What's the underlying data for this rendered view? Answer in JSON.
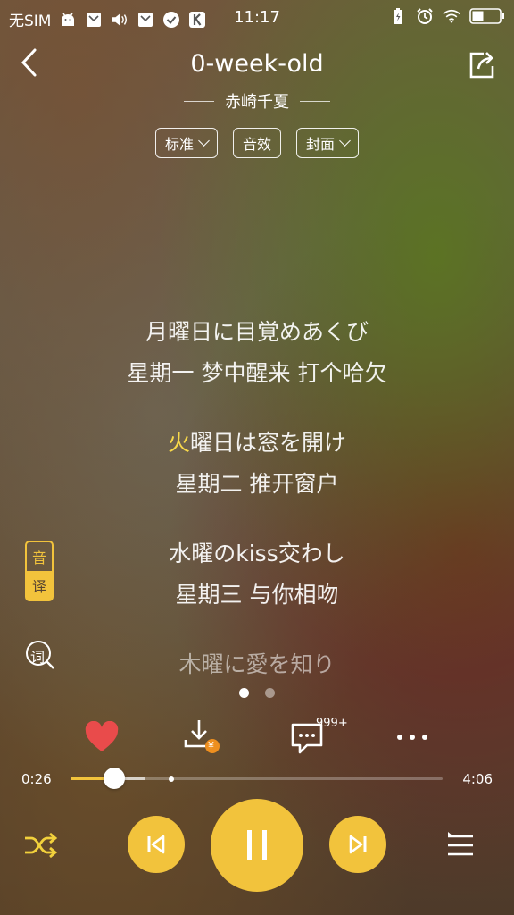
{
  "status": {
    "carrier": "无SIM",
    "time": "11:17",
    "icons": [
      "android-icon",
      "mail-icon",
      "volume-icon",
      "mail-icon",
      "check-circle-icon",
      "k-app-icon",
      "battery-saver-icon",
      "alarm-icon",
      "wifi-icon",
      "battery-icon"
    ]
  },
  "header": {
    "title": "0-week-old",
    "artist": "赤崎千夏",
    "chips": [
      "标准",
      "音效",
      "封面"
    ]
  },
  "lyrics": {
    "l1_jp": "月曜日に目覚めあくび",
    "l1_cn": "星期一 梦中醒来 打个哈欠",
    "l2_jp_hl": "火",
    "l2_jp_rest": "曜日は窓を開け",
    "l2_cn": "星期二 推开窗户",
    "l3_jp": "水曜のkiss交わし",
    "l3_cn": "星期三 与你相吻",
    "l4_jp": "木曜に愛を知り"
  },
  "side": {
    "yin": "音",
    "yi": "译",
    "ci": "词"
  },
  "actions": {
    "comment_badge": "999+",
    "download_coin": "¥"
  },
  "progress": {
    "current": "0:26",
    "total": "4:06",
    "played_fraction": 0.106
  },
  "colors": {
    "accent": "#f2c33c",
    "highlight": "#f7d84a",
    "heart": "#e94b4b"
  }
}
